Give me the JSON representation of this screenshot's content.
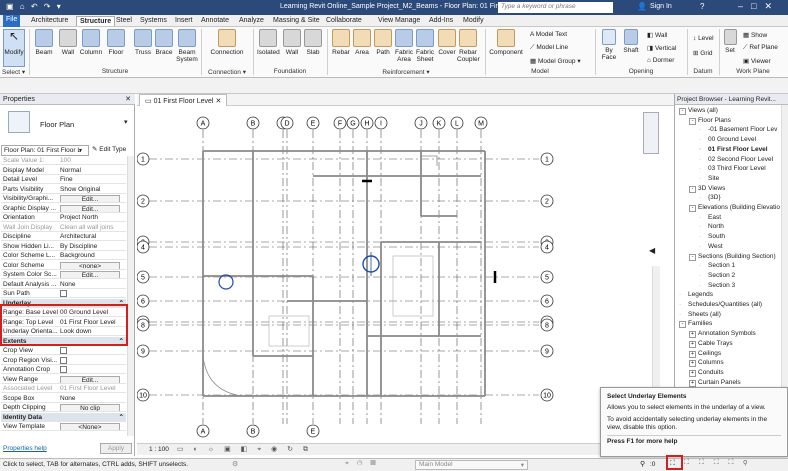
{
  "titlebar": {
    "title": "Learning Revit Online_Sample Project_M2_Beams - Floor Plan: 01 First Flo...",
    "search_placeholder": "Type a keyword or phrase",
    "sign_in": "Sign In"
  },
  "tabs": [
    "File",
    "Architecture",
    "Structure",
    "Steel",
    "Systems",
    "Insert",
    "Annotate",
    "Analyze",
    "Massing & Site",
    "Collaborate",
    "View",
    "Manage",
    "Add-Ins",
    "Modify"
  ],
  "ribbon": {
    "modify": "Modify",
    "select": "Select",
    "structure_buttons": [
      "Beam",
      "Wall",
      "Column",
      "Floor",
      "Truss",
      "Brace",
      "Beam System"
    ],
    "structure_group": "Structure",
    "connection_buttons": [
      "Connection"
    ],
    "connection_group": "Connection",
    "foundation_buttons": [
      "Isolated",
      "Wall",
      "Slab"
    ],
    "foundation_group": "Foundation",
    "reinforcement_buttons": [
      "Rebar",
      "Area",
      "Path",
      "Fabric Area",
      "Fabric Sheet",
      "Cover",
      "Rebar Coupler"
    ],
    "reinforcement_group": "Reinforcement",
    "component": "Component",
    "model_items": [
      "Model Text",
      "Model Line",
      "Model Group"
    ],
    "model_group": "Model",
    "opening_buttons": [
      "By Face",
      "Shaft"
    ],
    "opening_items": [
      "Wall",
      "Vertical",
      "Dormer"
    ],
    "opening_group": "Opening",
    "datum_items": [
      "Level",
      "Grid"
    ],
    "datum_group": "Datum",
    "workplane_buttons": [
      "Set"
    ],
    "workplane_items": [
      "Show",
      "Ref Plane",
      "Viewer"
    ],
    "workplane_group": "Work Plane"
  },
  "properties": {
    "title": "Properties",
    "type_name": "Floor Plan",
    "selector": "Floor Plan: 01 First Floor L",
    "edit_type": "Edit Type",
    "rows": [
      {
        "k": "Scale Value  1:",
        "v": "100",
        "style": "grey"
      },
      {
        "k": "Display Model",
        "v": "Normal"
      },
      {
        "k": "Detail Level",
        "v": "Fine"
      },
      {
        "k": "Parts Visibility",
        "v": "Show Original"
      },
      {
        "k": "Visibility/Graphi...",
        "v": "Edit...",
        "btn": true
      },
      {
        "k": "Graphic Display ...",
        "v": "Edit...",
        "btn": true
      },
      {
        "k": "Orientation",
        "v": "Project North"
      },
      {
        "k": "Wall Join Display",
        "v": "Clean all wall joins",
        "style": "grey"
      },
      {
        "k": "Discipline",
        "v": "Architectural"
      },
      {
        "k": "Show Hidden Li...",
        "v": "By Discipline"
      },
      {
        "k": "Color Scheme L...",
        "v": "Background"
      },
      {
        "k": "Color Scheme",
        "v": "<none>",
        "btn": true
      },
      {
        "k": "System Color Sc...",
        "v": "Edit...",
        "btn": true
      },
      {
        "k": "Default Analysis ...",
        "v": "None"
      },
      {
        "k": "Sun Path",
        "v": "",
        "chk": true
      },
      {
        "k": "Underlay",
        "v": "",
        "style": "section"
      },
      {
        "k": "Range: Base Level",
        "v": "00 Ground Level"
      },
      {
        "k": "Range: Top Level",
        "v": "01 First Floor Level"
      },
      {
        "k": "Underlay Orienta...",
        "v": "Look down"
      },
      {
        "k": "Extents",
        "v": "",
        "style": "section"
      },
      {
        "k": "Crop View",
        "v": "",
        "chk": true
      },
      {
        "k": "Crop Region Visi...",
        "v": "",
        "chk": true
      },
      {
        "k": "Annotation Crop",
        "v": "",
        "chk": true
      },
      {
        "k": "View Range",
        "v": "Edit...",
        "btn": true
      },
      {
        "k": "Associated Level",
        "v": "01 First Floor Level",
        "style": "grey"
      },
      {
        "k": "Scope Box",
        "v": "None"
      },
      {
        "k": "Depth Clipping",
        "v": "No clip",
        "btn": true
      },
      {
        "k": "Identity Data",
        "v": "",
        "style": "section"
      },
      {
        "k": "View Template",
        "v": "<None>",
        "btn": true
      }
    ],
    "help_link": "Properties help",
    "apply": "Apply"
  },
  "view": {
    "tab_label": "01 First Floor Level",
    "grid_top": [
      "A",
      "B",
      "C",
      "D",
      "E",
      "F",
      "G",
      "H",
      "I",
      "J",
      "K",
      "L",
      "M"
    ],
    "grid_side": [
      "1",
      "2",
      "3",
      "4",
      "5",
      "6",
      "7",
      "8",
      "9",
      "10"
    ],
    "scale": "1 : 100"
  },
  "browser": {
    "title": "Project Browser - Learning Revit...",
    "items": [
      {
        "t": "Views (all)",
        "lvl": 0,
        "exp": "-"
      },
      {
        "t": "Floor Plans",
        "lvl": 1,
        "exp": "-"
      },
      {
        "t": "-01 Basement Floor Lev",
        "lvl": 2
      },
      {
        "t": "00 Ground Level",
        "lvl": 2
      },
      {
        "t": "01 First Floor Level",
        "lvl": 2,
        "bold": true
      },
      {
        "t": "02 Second Floor Level",
        "lvl": 2
      },
      {
        "t": "03 Third Floor Level",
        "lvl": 2
      },
      {
        "t": "Site",
        "lvl": 2
      },
      {
        "t": "3D Views",
        "lvl": 1,
        "exp": "-"
      },
      {
        "t": "{3D}",
        "lvl": 2
      },
      {
        "t": "Elevations (Building Elevatio",
        "lvl": 1,
        "exp": "-"
      },
      {
        "t": "East",
        "lvl": 2
      },
      {
        "t": "North",
        "lvl": 2
      },
      {
        "t": "South",
        "lvl": 2
      },
      {
        "t": "West",
        "lvl": 2
      },
      {
        "t": "Sections (Building Section)",
        "lvl": 1,
        "exp": "-"
      },
      {
        "t": "Section 1",
        "lvl": 2
      },
      {
        "t": "Section 2",
        "lvl": 2
      },
      {
        "t": "Section 3",
        "lvl": 2
      },
      {
        "t": "Legends",
        "lvl": 0
      },
      {
        "t": "Schedules/Quantities (all)",
        "lvl": 0
      },
      {
        "t": "Sheets (all)",
        "lvl": 0
      },
      {
        "t": "Families",
        "lvl": 0,
        "exp": "-"
      },
      {
        "t": "Annotation Symbols",
        "lvl": 1,
        "exp": "+"
      },
      {
        "t": "Cable Trays",
        "lvl": 1,
        "exp": "+"
      },
      {
        "t": "Ceilings",
        "lvl": 1,
        "exp": "+"
      },
      {
        "t": "Columns",
        "lvl": 1,
        "exp": "+"
      },
      {
        "t": "Conduits",
        "lvl": 1,
        "exp": "+"
      },
      {
        "t": "Curtain Panels",
        "lvl": 1,
        "exp": "+"
      }
    ]
  },
  "tooltip": {
    "title": "Select Underlay Elements",
    "line1": "Allows you to select elements in the underlay of a view.",
    "line2": "To avoid accidentally selecting underlay elements in the view, disable this option.",
    "help": "Press F1 for more help"
  },
  "status": {
    "text": "Click to select, TAB for alternates, CTRL adds, SHIFT unselects.",
    "workset": "Main Model",
    "count": ":0"
  },
  "colors": {
    "title_bar": "#2b4a7a",
    "file_tab": "#2b6cc4",
    "highlight_box": "#d21f1f"
  }
}
